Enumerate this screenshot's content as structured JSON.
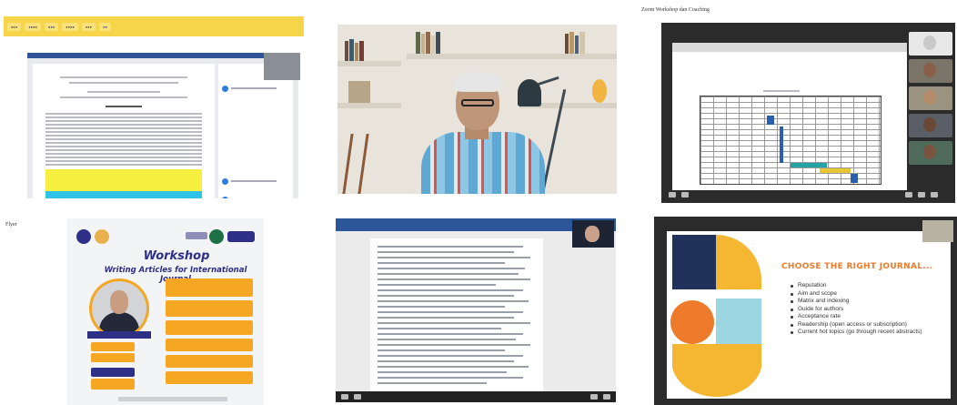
{
  "captions": {
    "top_right": "Zoom Workshop dan Coaching",
    "bottom_left": "Flyer"
  },
  "tile_document": {
    "tabs": [
      "",
      "",
      "",
      "",
      "",
      ""
    ]
  },
  "tile_poster": {
    "title": "Workshop",
    "subtitle": "Writing Articles for International Journal"
  },
  "tile_slide": {
    "title": "CHOOSE THE RIGHT JOURNAL...",
    "bullets": [
      "Reputation",
      "Aim and scope",
      "Matrix and indexing",
      "Guide for authors",
      "Acceptance rate",
      "Readership (open access or subscription)",
      "Current hot topics (go through recent abstracts)"
    ]
  },
  "colors": {
    "accent_orange": "#f07a2a",
    "poster_navy": "#2e2f86",
    "poster_yellow": "#f5a623",
    "word_blue": "#2b579a"
  }
}
